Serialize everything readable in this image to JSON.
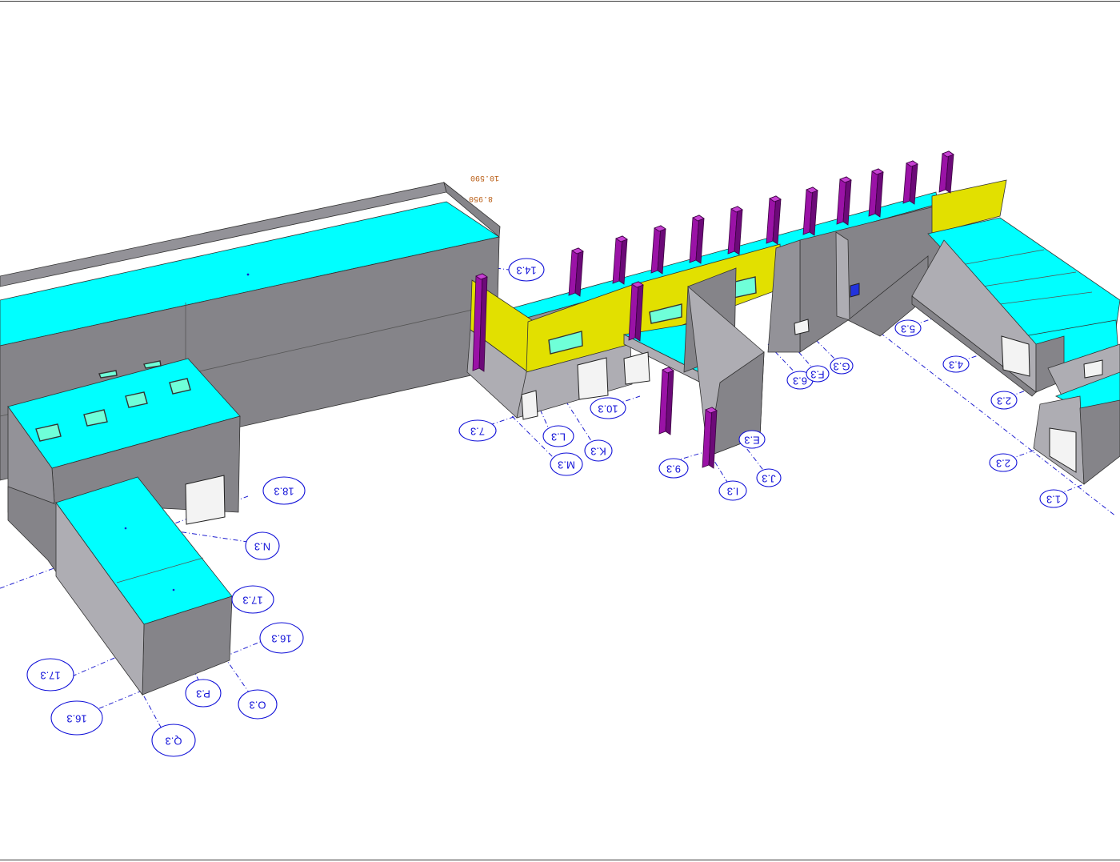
{
  "view": {
    "background": "#ffffff",
    "colors": {
      "roof": "#00ffff",
      "wall": "#858489",
      "accent_panel": "#e2e000",
      "structural_post": "#9a12a6",
      "gridline": "#1010d8",
      "window": "#6fffd8"
    }
  },
  "gridlines": [
    {
      "label": "14.3"
    },
    {
      "label": "18.3"
    },
    {
      "label": "N.3"
    },
    {
      "label": "17.3"
    },
    {
      "label": "16.3"
    },
    {
      "label": "17.3"
    },
    {
      "label": "16.3"
    },
    {
      "label": "P.3"
    },
    {
      "label": "O.3"
    },
    {
      "label": "Q.3"
    },
    {
      "label": "7.3"
    },
    {
      "label": "L.3"
    },
    {
      "label": "M.3"
    },
    {
      "label": "K.3"
    },
    {
      "label": "10.3"
    },
    {
      "label": "9.3"
    },
    {
      "label": "I.3"
    },
    {
      "label": "J.3"
    },
    {
      "label": "E.3"
    },
    {
      "label": "6.3"
    },
    {
      "label": "F.3"
    },
    {
      "label": "G.3"
    },
    {
      "label": "5.3"
    },
    {
      "label": "4.3"
    },
    {
      "label": "2.3"
    },
    {
      "label": "2.3"
    },
    {
      "label": "1.3"
    }
  ],
  "elevation_tags": [
    {
      "text": "10.590"
    },
    {
      "text": "8.950"
    }
  ]
}
